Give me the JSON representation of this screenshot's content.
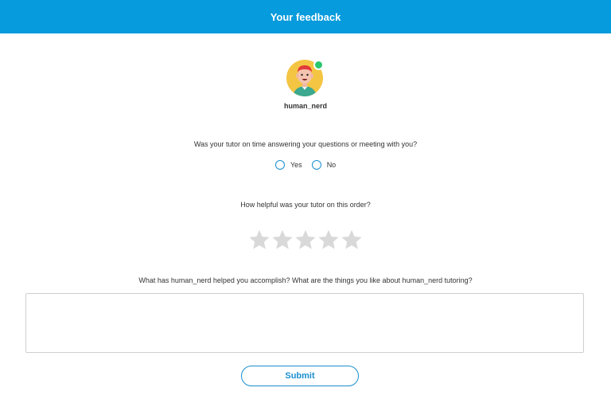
{
  "header": {
    "title": "Your feedback"
  },
  "tutor": {
    "username": "human_nerd",
    "status": "online"
  },
  "questions": {
    "on_time": "Was your tutor on time answering your questions or meeting with you?",
    "helpful": "How helpful was your tutor on this order?",
    "accomplish": "What has human_nerd helped you accomplish? What are the things you like about human_nerd tutoring?"
  },
  "on_time_options": [
    "Yes",
    "No"
  ],
  "rating": {
    "max": 5,
    "value": 0
  },
  "feedback_text": {
    "value": "",
    "placeholder": ""
  },
  "submit_label": "Submit",
  "colors": {
    "header_bg": "#059bdc",
    "accent": "#1a8fd0",
    "star_empty": "#d9d9d9",
    "status_online": "#29c76f",
    "avatar_bg": "#f4c542"
  }
}
